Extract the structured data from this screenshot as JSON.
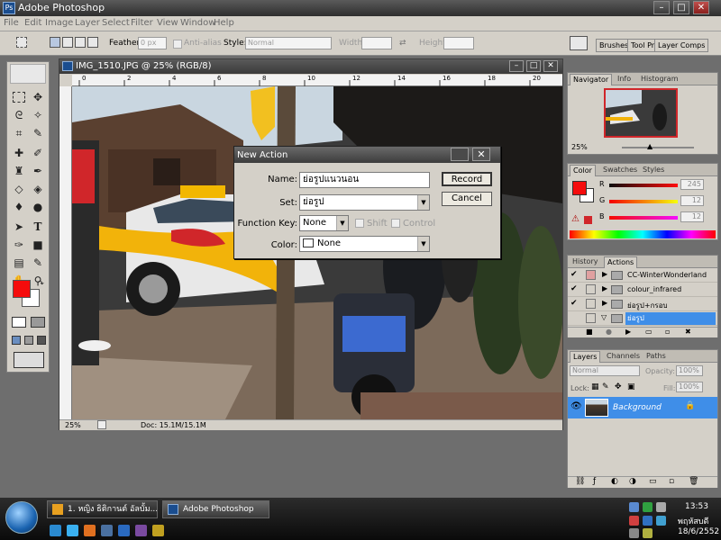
{
  "window": {
    "title": "Adobe Photoshop"
  },
  "menu": [
    "File",
    "Edit",
    "Image",
    "Layer",
    "Select",
    "Filter",
    "View",
    "Window",
    "Help"
  ],
  "options": {
    "feather_label": "Feather:",
    "feather_value": "0 px",
    "antialias_label": "Anti-alias",
    "style_label": "Style:",
    "style_value": "Normal",
    "width_label": "Width:",
    "height_label": "Height:",
    "dock_tabs": [
      "Brushes",
      "Tool Pr",
      "Layer Comps"
    ]
  },
  "document": {
    "title": "IMG_1510.JPG @ 25% (RGB/8)",
    "zoom": "25%",
    "doc_info": "Doc: 15.1M/15.1M",
    "ruler_labels": [
      "0",
      "2",
      "4",
      "6",
      "8",
      "10",
      "12",
      "14",
      "16",
      "18",
      "20",
      "22"
    ]
  },
  "dialog": {
    "title": "New Action",
    "name_label": "Name:",
    "name_value": "ย่อรูปแนวนอน",
    "set_label": "Set:",
    "set_value": "ย่อรูป",
    "fkey_label": "Function Key:",
    "fkey_value": "None",
    "shift_label": "Shift",
    "control_label": "Control",
    "color_label": "Color:",
    "color_value": "None",
    "record_label": "Record",
    "cancel_label": "Cancel"
  },
  "navigator": {
    "tabs": [
      "Navigator",
      "Info",
      "Histogram"
    ],
    "zoom": "25%"
  },
  "color_panel": {
    "tabs": [
      "Color",
      "Swatches",
      "Styles"
    ],
    "r_label": "R",
    "g_label": "G",
    "b_label": "B",
    "r_value": "245",
    "g_value": "12",
    "b_value": "12",
    "foreground": "#f50c0c"
  },
  "actions": {
    "tabs": [
      "History",
      "Actions"
    ],
    "items": [
      "CC-WinterWonderland",
      "colour_infrared",
      "ย่อรูป+กรอบ",
      "ย่อรูป"
    ]
  },
  "layers": {
    "tabs": [
      "Layers",
      "Channels",
      "Paths"
    ],
    "blend_mode": "Normal",
    "opacity_label": "Opacity:",
    "opacity_value": "100%",
    "lock_label": "Lock:",
    "fill_label": "Fill:",
    "fill_value": "100%",
    "layer_name": "Background"
  },
  "taskbar": {
    "buttons": [
      "1. หญิง ธิติกานต์ อัลบั้ม...",
      "Adobe Photoshop"
    ],
    "time": "13:53",
    "day": "พฤหัสบดี",
    "date": "18/6/2552"
  }
}
